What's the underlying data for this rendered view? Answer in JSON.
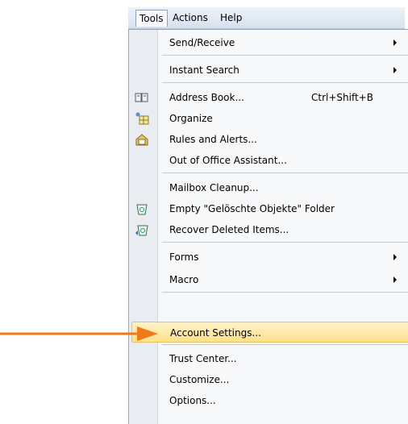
{
  "menubar": {
    "items": [
      {
        "label": "Tools",
        "active": true
      },
      {
        "label": "Actions",
        "active": false
      },
      {
        "label": "Help",
        "active": false
      }
    ]
  },
  "menu": {
    "items": [
      {
        "label": "Send/Receive",
        "submenu": true
      },
      {
        "label": "Instant Search",
        "submenu": true
      },
      {
        "label": "Address Book...",
        "shortcut": "Ctrl+Shift+B",
        "icon": "address-book-icon"
      },
      {
        "label": "Organize",
        "icon": "organize-icon"
      },
      {
        "label": "Rules and Alerts...",
        "icon": "rules-alerts-icon"
      },
      {
        "label": "Out of Office Assistant..."
      },
      {
        "label": "Mailbox Cleanup..."
      },
      {
        "label": "Empty \"Gelöschte Objekte\" Folder",
        "icon": "empty-trash-icon"
      },
      {
        "label": "Recover Deleted Items...",
        "icon": "recover-items-icon"
      },
      {
        "label": "Forms",
        "submenu": true
      },
      {
        "label": "Macro",
        "submenu": true
      },
      {
        "label": "Account Settings...",
        "highlighted": true
      },
      {
        "label": "Trust Center..."
      },
      {
        "label": "Customize..."
      },
      {
        "label": "Options..."
      }
    ]
  },
  "colors": {
    "pointer_arrow": "#f07a1a",
    "highlight": "#ffe08a"
  }
}
